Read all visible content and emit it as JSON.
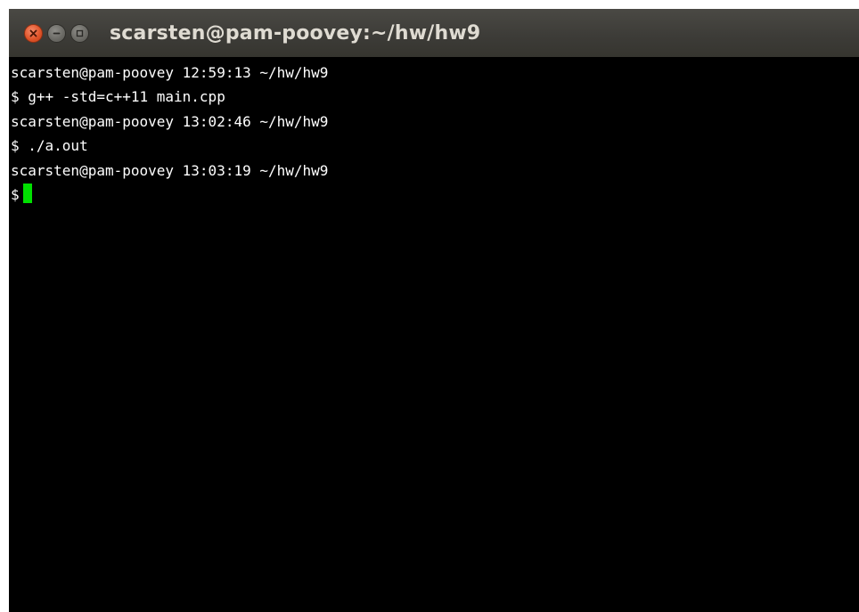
{
  "window": {
    "title": "scarsten@pam-poovey:~/hw/hw9"
  },
  "terminal": {
    "lines": [
      "scarsten@pam-poovey 12:59:13 ~/hw/hw9",
      "$ g++ -std=c++11 main.cpp",
      "scarsten@pam-poovey 13:02:46 ~/hw/hw9",
      "$ ./a.out",
      "scarsten@pam-poovey 13:03:19 ~/hw/hw9"
    ],
    "prompt": "$",
    "cursor_color": "#00e000",
    "background": "#000000",
    "foreground": "#ffffff"
  },
  "icons": {
    "close": "close-icon",
    "minimize": "minimize-icon",
    "maximize": "maximize-icon"
  }
}
